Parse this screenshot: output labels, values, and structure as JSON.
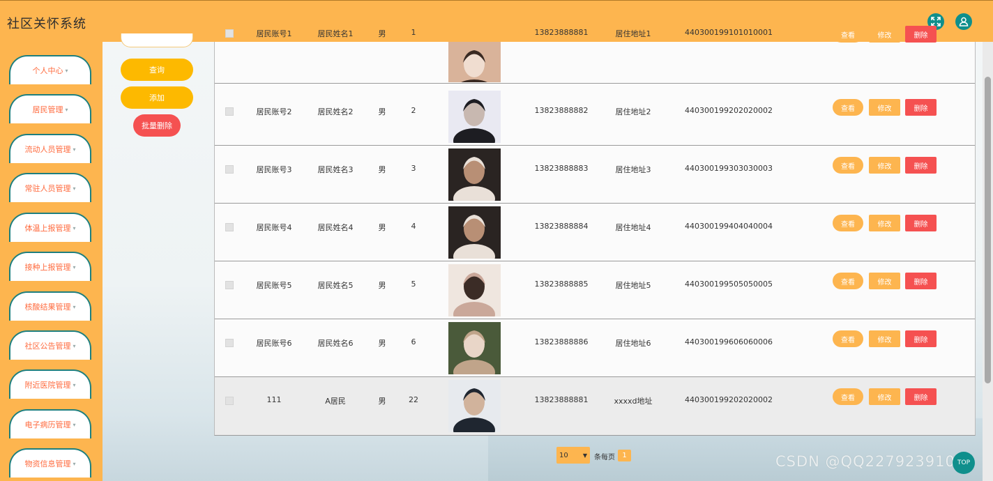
{
  "app": {
    "title": "社区关怀系统"
  },
  "header": {
    "fullscreen_icon": "expand-icon",
    "user_icon": "user-icon"
  },
  "sidebar": {
    "items": [
      {
        "label": "个人中心"
      },
      {
        "label": "居民管理"
      },
      {
        "label": "流动人员管理"
      },
      {
        "label": "常驻人员管理"
      },
      {
        "label": "体温上报管理"
      },
      {
        "label": "接种上报管理"
      },
      {
        "label": "核酸结果管理"
      },
      {
        "label": "社区公告管理"
      },
      {
        "label": "附近医院管理"
      },
      {
        "label": "电子病历管理"
      },
      {
        "label": "物资信息管理"
      }
    ]
  },
  "actions": {
    "query": "查询",
    "add": "添加",
    "batch_delete": "批量删除"
  },
  "rows": [
    {
      "account": "居民账号1",
      "name": "居民姓名1",
      "gender": "男",
      "age": "1",
      "phone": "13823888881",
      "address": "居住地址1",
      "id_no": "440300199101010001"
    },
    {
      "account": "居民账号2",
      "name": "居民姓名2",
      "gender": "男",
      "age": "2",
      "phone": "13823888882",
      "address": "居住地址2",
      "id_no": "440300199202020002"
    },
    {
      "account": "居民账号3",
      "name": "居民姓名3",
      "gender": "男",
      "age": "3",
      "phone": "13823888883",
      "address": "居住地址3",
      "id_no": "440300199303030003"
    },
    {
      "account": "居民账号4",
      "name": "居民姓名4",
      "gender": "男",
      "age": "4",
      "phone": "13823888884",
      "address": "居住地址4",
      "id_no": "440300199404040004"
    },
    {
      "account": "居民账号5",
      "name": "居民姓名5",
      "gender": "男",
      "age": "5",
      "phone": "13823888885",
      "address": "居住地址5",
      "id_no": "440300199505050005"
    },
    {
      "account": "居民账号6",
      "name": "居民姓名6",
      "gender": "男",
      "age": "6",
      "phone": "13823888886",
      "address": "居住地址6",
      "id_no": "440300199606060006"
    },
    {
      "account": "111",
      "name": "A居民",
      "gender": "男",
      "age": "22",
      "phone": "13823888881",
      "address": "xxxxd地址",
      "id_no": "440300199202020002"
    }
  ],
  "row_actions": {
    "view": "查看",
    "edit": "修改",
    "delete": "删除"
  },
  "pagination": {
    "page_size": "10",
    "per_page_label": "条每页",
    "current_page": "1"
  },
  "watermark": "CSDN @QQ2279239102",
  "back_to_top": "TOP",
  "colors": {
    "header": "#fdb54f",
    "accent_teal": "#0f8f8c",
    "delete": "#f55151"
  }
}
